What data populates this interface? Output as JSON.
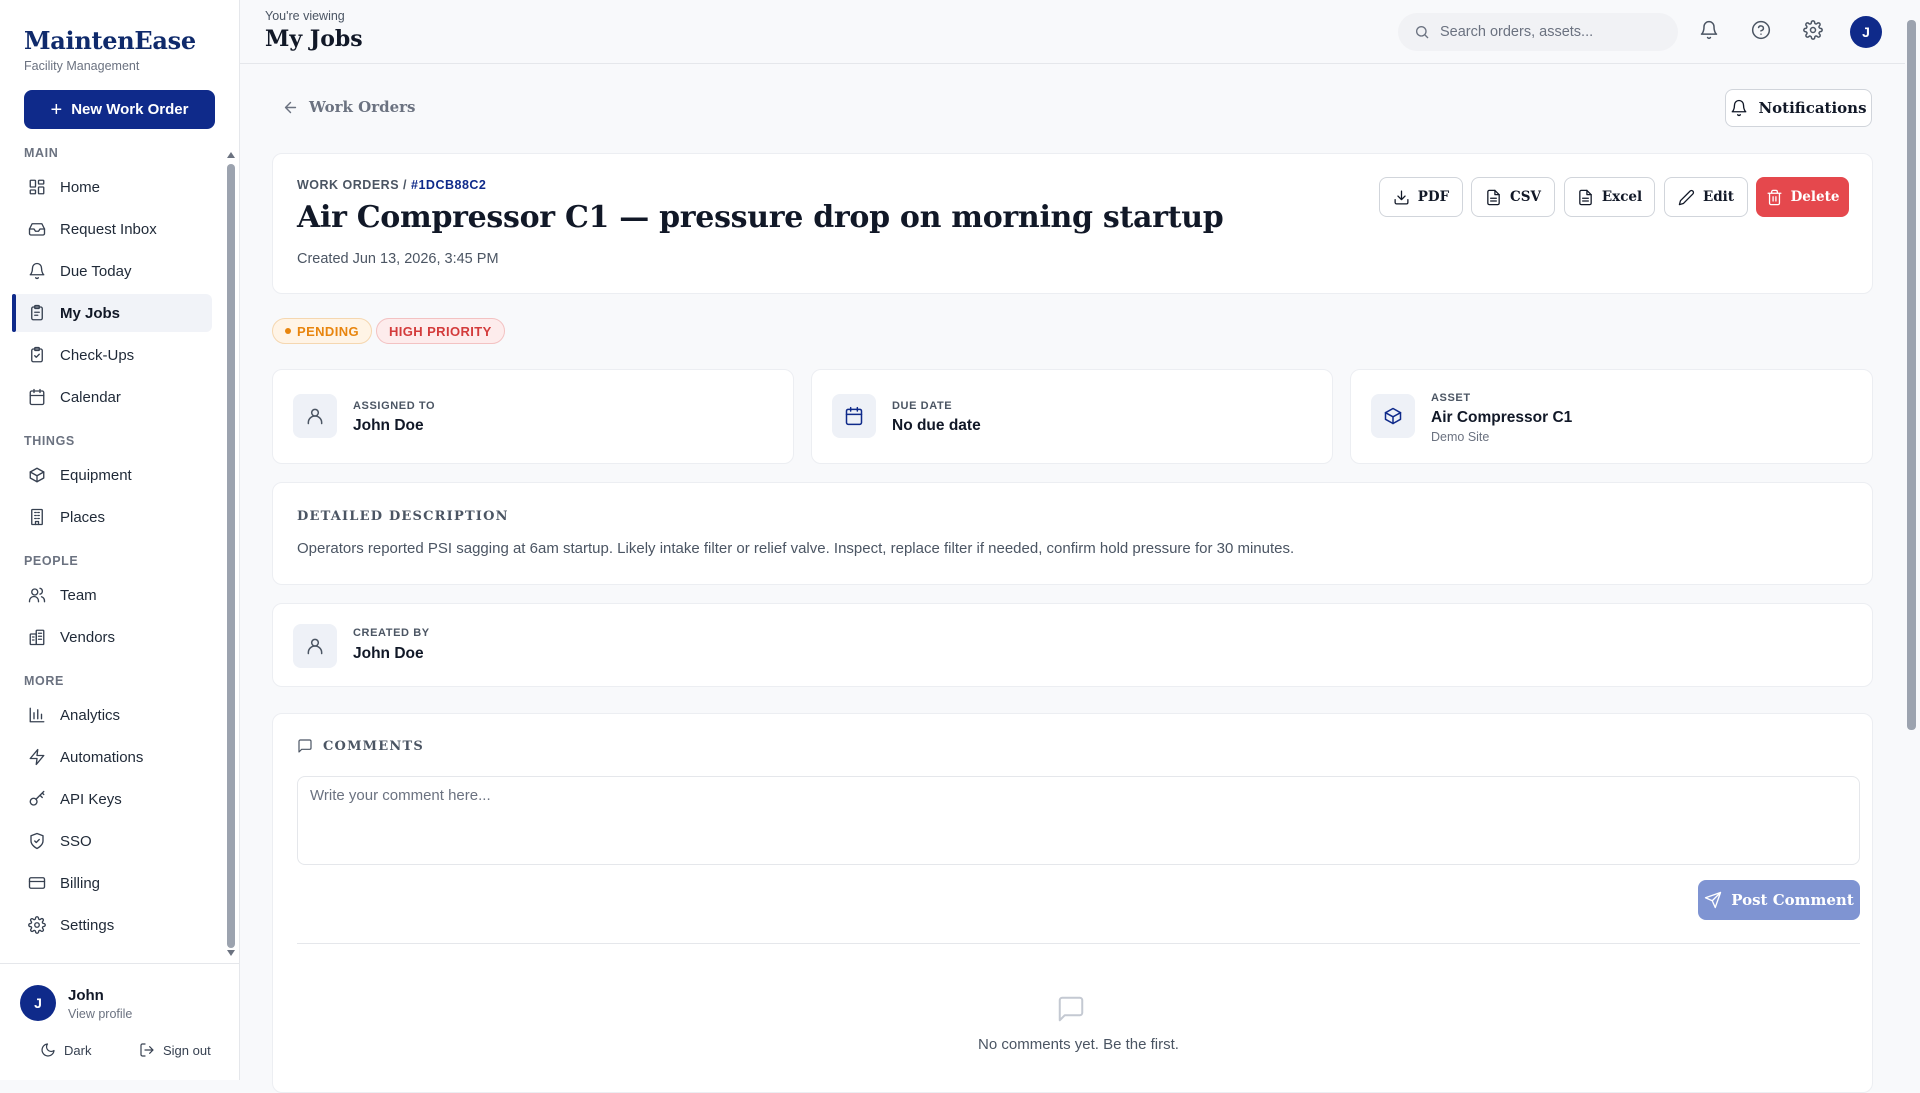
{
  "brand": {
    "name": "MaintenEase",
    "subtitle": "Facility Management"
  },
  "new_work_order_label": "New Work Order",
  "nav": {
    "sections": {
      "main": "MAIN",
      "things": "THINGS",
      "people": "PEOPLE",
      "more": "MORE"
    },
    "items": {
      "home": "Home",
      "request_inbox": "Request Inbox",
      "due_today": "Due Today",
      "my_jobs": "My Jobs",
      "check_ups": "Check-Ups",
      "calendar": "Calendar",
      "equipment": "Equipment",
      "places": "Places",
      "team": "Team",
      "vendors": "Vendors",
      "analytics": "Analytics",
      "automations": "Automations",
      "api_keys": "API Keys",
      "sso": "SSO",
      "billing": "Billing",
      "settings": "Settings"
    },
    "active": "My Jobs"
  },
  "user": {
    "initial": "J",
    "name": "John",
    "view_profile": "View profile",
    "dark_label": "Dark",
    "sign_out_label": "Sign out"
  },
  "topbar": {
    "viewing_label": "You're viewing",
    "page_title": "My Jobs",
    "search_placeholder": "Search orders, assets..."
  },
  "back_label": "Work Orders",
  "notifications_label": "Notifications",
  "work_order": {
    "crumb_section": "WORK ORDERS",
    "crumb_sep": "/",
    "id": "#1DCB88C2",
    "title": "Air Compressor C1 — pressure drop on morning startup",
    "created": "Created Jun 13, 2026, 3:45 PM",
    "actions": {
      "pdf": "PDF",
      "csv": "CSV",
      "excel": "Excel",
      "edit": "Edit",
      "delete": "Delete"
    },
    "status": "PENDING",
    "priority": "HIGH PRIORITY",
    "assigned": {
      "label": "ASSIGNED TO",
      "value": "John Doe"
    },
    "due": {
      "label": "DUE DATE",
      "value": "No due date"
    },
    "asset": {
      "label": "ASSET",
      "value": "Air Compressor C1",
      "site": "Demo Site"
    },
    "description": {
      "heading": "DETAILED DESCRIPTION",
      "text": "Operators reported PSI sagging at 6am startup. Likely intake filter or relief valve. Inspect, replace filter if needed, confirm hold pressure for 30 minutes."
    },
    "created_by": {
      "label": "CREATED BY",
      "value": "John Doe"
    }
  },
  "comments": {
    "heading": "COMMENTS",
    "placeholder": "Write your comment here...",
    "post_label": "Post Comment",
    "empty_text": "No comments yet. Be the first."
  },
  "colors": {
    "brand_navy": "#0f2a8a",
    "danger": "#e5484d",
    "pending": "#e8850e",
    "high_priority": "#d33b3b"
  }
}
